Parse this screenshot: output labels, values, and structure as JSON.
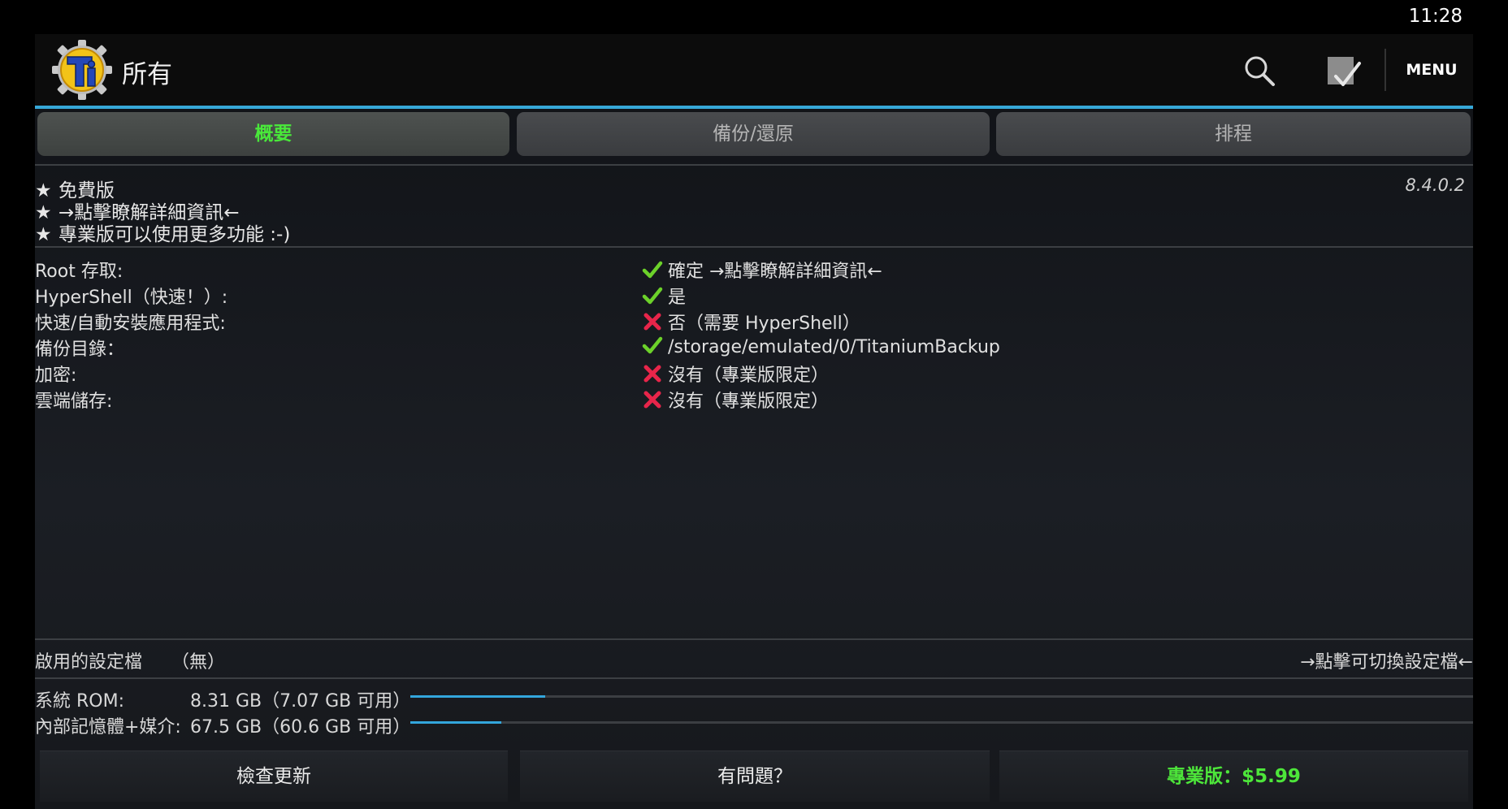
{
  "status_bar": {
    "time": "11:28"
  },
  "action_bar": {
    "title": "所有",
    "menu_label": "MENU",
    "icons": [
      "app-logo-icon",
      "search-icon",
      "batch-check-icon"
    ],
    "accent_color": "#36a8d8"
  },
  "tabs": [
    {
      "label": "概要",
      "active": true
    },
    {
      "label": "備份/還原",
      "active": false
    },
    {
      "label": "排程",
      "active": false
    }
  ],
  "info": {
    "lines": [
      "免費版",
      "→點擊瞭解詳細資訊←",
      "專業版可以使用更多功能 :-)"
    ],
    "star_glyph": "★",
    "version": "8.4.0.2"
  },
  "status_rows": [
    {
      "label": "Root 存取:",
      "ok": true,
      "value": "確定 →點擊瞭解詳細資訊←"
    },
    {
      "label": "HyperShell（快速！）:",
      "ok": true,
      "value": "是"
    },
    {
      "label": "快速/自動安裝應用程式:",
      "ok": false,
      "value": "否（需要 HyperShell）"
    },
    {
      "label": "備份目錄：",
      "ok": true,
      "value": "/storage/emulated/0/TitaniumBackup"
    },
    {
      "label": "加密:",
      "ok": false,
      "value": "沒有（專業版限定）"
    },
    {
      "label": "雲端儲存:",
      "ok": false,
      "value": "沒有（專業版限定）"
    }
  ],
  "profile": {
    "label": "啟用的設定檔",
    "value": "（無）",
    "switch_label": "→點擊可切換設定檔←"
  },
  "storage": [
    {
      "label": "系統 ROM:",
      "value": "8.31 GB（7.07 GB 可用）",
      "used_fraction": 0.127
    },
    {
      "label": "內部記憶體+媒介:",
      "value": "67.5 GB（60.6 GB 可用）",
      "used_fraction": 0.086
    }
  ],
  "buttons": {
    "check_update": "檢查更新",
    "help": "有問題？",
    "pro": "專業版：$5.99"
  },
  "colors": {
    "ok": "#6cd12a",
    "error": "#e8254a",
    "pro_green": "#4de63a",
    "progress": "#33a6dc"
  }
}
